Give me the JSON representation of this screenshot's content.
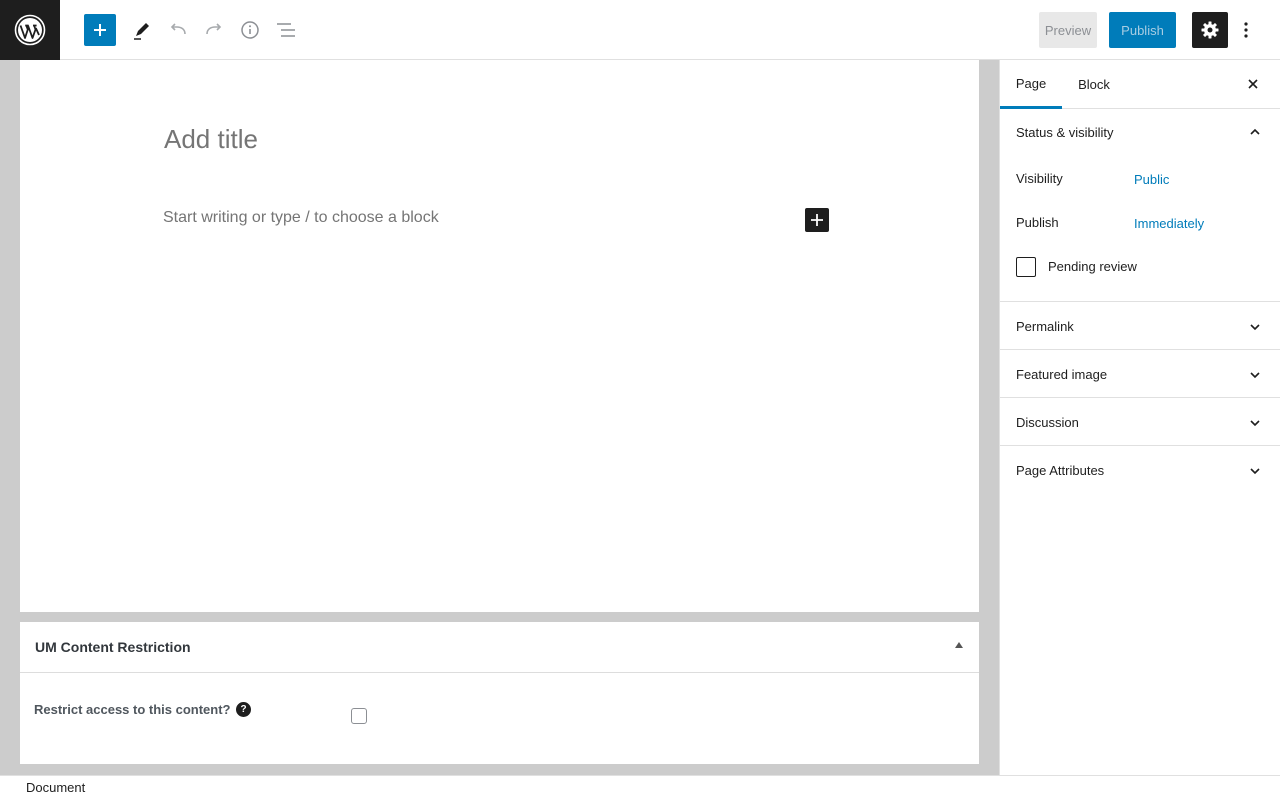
{
  "toolbar": {
    "add_block_icon": "plus-icon",
    "tools_icon": "pencil-icon",
    "undo_icon": "undo-icon",
    "redo_icon": "redo-icon",
    "details_icon": "info-icon",
    "outline_icon": "list-view-icon",
    "preview_label": "Preview",
    "publish_label": "Publish",
    "settings_icon": "gear-icon",
    "more_icon": "more-vertical-icon"
  },
  "editor": {
    "title_placeholder": "Add title",
    "block_placeholder": "Start writing or type / to choose a block"
  },
  "metabox": {
    "title": "UM Content Restriction",
    "restrict_label": "Restrict access to this content?",
    "help_glyph": "?",
    "restrict_checked": false
  },
  "sidebar": {
    "tabs": [
      {
        "label": "Page",
        "active": true
      },
      {
        "label": "Block",
        "active": false
      }
    ],
    "status_panel": {
      "title": "Status & visibility",
      "expanded": true,
      "visibility_label": "Visibility",
      "visibility_value": "Public",
      "publish_label": "Publish",
      "publish_value": "Immediately",
      "pending_label": "Pending review",
      "pending_checked": false
    },
    "panels": [
      {
        "title": "Permalink"
      },
      {
        "title": "Featured image"
      },
      {
        "title": "Discussion"
      },
      {
        "title": "Page Attributes"
      }
    ]
  },
  "footer": {
    "breadcrumb": "Document"
  },
  "colors": {
    "accent": "#007cba",
    "dark": "#1e1e1e",
    "editor_bg": "#cccccc"
  }
}
